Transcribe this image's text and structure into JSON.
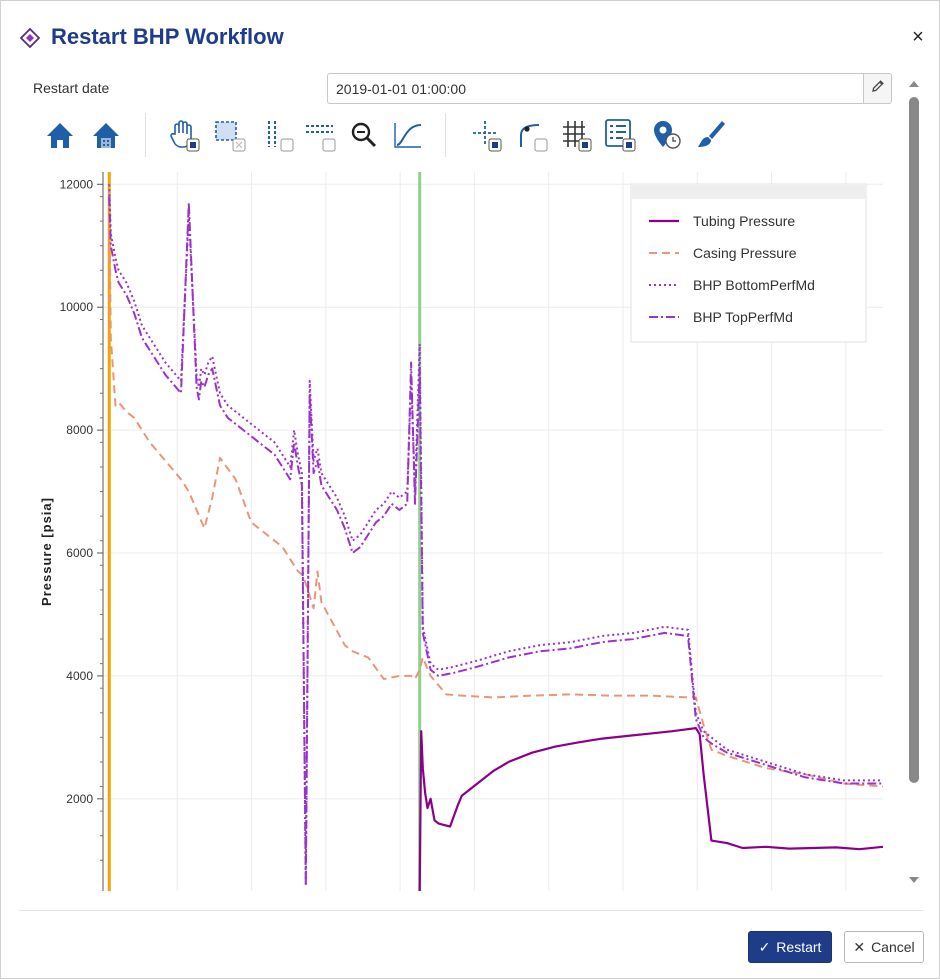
{
  "dialog": {
    "title": "Restart BHP Workflow",
    "title_icon": "diamond-workflow-icon",
    "close_icon": "close-icon",
    "close_label": "×"
  },
  "restart_date": {
    "label": "Restart date",
    "value": "2019-01-01 01:00:00",
    "edit_icon": "pencil-icon"
  },
  "toolbar": {
    "tools": [
      {
        "name": "reset-view-tool",
        "icon": "home-icon"
      },
      {
        "name": "save-view-tool",
        "icon": "home-solid-icon"
      },
      {
        "name": "pan-tool",
        "icon": "hand-pan-icon"
      },
      {
        "name": "box-zoom-tool",
        "icon": "box-zoom-icon"
      },
      {
        "name": "xbox-select-tool",
        "icon": "vertical-select-icon"
      },
      {
        "name": "ybox-select-tool",
        "icon": "horizontal-select-icon"
      },
      {
        "name": "zoom-tool",
        "icon": "magnifier-icon"
      },
      {
        "name": "curve-tool",
        "icon": "curve-icon"
      },
      {
        "name": "crosshair-tool",
        "icon": "crosshair-icon"
      },
      {
        "name": "point-draw-tool",
        "icon": "point-draw-icon"
      },
      {
        "name": "grid-tool",
        "icon": "grid-icon"
      },
      {
        "name": "legend-tool",
        "icon": "legend-list-icon"
      },
      {
        "name": "hover-tool",
        "icon": "hover-clock-icon"
      },
      {
        "name": "paint-tool",
        "icon": "paint-brush-icon"
      }
    ]
  },
  "chart_data": {
    "type": "line",
    "title": "",
    "xlabel": "",
    "ylabel": "Pressure [psia]",
    "ylim": [
      500,
      12200
    ],
    "yticks": [
      2000,
      4000,
      6000,
      8000,
      10000,
      12000
    ],
    "ytick_labels": [
      "2000",
      "4000",
      "6000",
      "8000",
      "10000",
      "12000"
    ],
    "xlim": [
      0,
      100
    ],
    "grid": true,
    "legend": "top-right",
    "vertical_markers": [
      {
        "x": 0.8,
        "color": "#f4a300"
      },
      {
        "x": 40.6,
        "color": "#8fd18a"
      }
    ],
    "series": [
      {
        "name": "Tubing Pressure",
        "color": "#8b008b",
        "dash": "solid",
        "width": 2.2,
        "x": [
          40.6,
          40.8,
          41.0,
          41.3,
          41.6,
          42.0,
          42.5,
          43.0,
          43.5,
          44.5,
          45.5,
          46.0,
          48.0,
          50.0,
          52.0,
          55.0,
          58.0,
          61.0,
          64.0,
          67.0,
          70.0,
          73.0,
          76.0,
          76.5,
          77.0,
          78.0,
          80.0,
          82.0,
          85.0,
          88.0,
          91.0,
          94.0,
          97.0,
          100.0
        ],
        "values": [
          500,
          3100,
          2500,
          2100,
          1850,
          2000,
          1650,
          1600,
          1580,
          1550,
          1900,
          2050,
          2250,
          2450,
          2600,
          2750,
          2850,
          2920,
          2980,
          3020,
          3060,
          3100,
          3150,
          3050,
          2400,
          1320,
          1280,
          1200,
          1220,
          1190,
          1200,
          1210,
          1180,
          1220
        ]
      },
      {
        "name": "Casing Pressure",
        "color": "#e8967a",
        "dash": "dashed",
        "width": 2,
        "x": [
          0.8,
          1.0,
          1.6,
          2.0,
          3.0,
          4.0,
          5.0,
          6.0,
          8.0,
          10.0,
          11.0,
          12.0,
          13.0,
          14.0,
          15.0,
          17.0,
          19.0,
          21.0,
          23.0,
          24.0,
          25.0,
          25.5,
          26.0,
          26.5,
          27.0,
          27.5,
          28.0,
          31.0,
          32.0,
          34.0,
          36.0,
          38.0,
          39.0,
          39.5,
          40.0,
          40.6,
          41.0,
          42.0,
          43.0,
          44.0,
          46.0,
          50.0,
          55.0,
          60.0,
          65.0,
          70.0,
          75.0,
          76.0,
          77.0,
          78.0,
          80.0,
          85.0,
          90.0,
          95.0,
          100.0
        ],
        "values": [
          11900,
          9500,
          8400,
          8450,
          8300,
          8200,
          8000,
          7800,
          7500,
          7200,
          7000,
          6700,
          6400,
          6900,
          7550,
          7200,
          6500,
          6300,
          6100,
          5900,
          5700,
          5650,
          5500,
          5300,
          5100,
          5700,
          5200,
          4500,
          4400,
          4300,
          3950,
          4000,
          4000,
          4000,
          3950,
          4100,
          4300,
          4000,
          3850,
          3700,
          3680,
          3650,
          3680,
          3700,
          3680,
          3680,
          3650,
          3650,
          3200,
          2800,
          2700,
          2500,
          2400,
          2250,
          2200
        ]
      },
      {
        "name": "BHP BottomPerfMd",
        "color": "#9933cc",
        "dash": "dotted",
        "width": 2,
        "x": [
          0.8,
          1.0,
          1.6,
          2.0,
          3.0,
          4.0,
          5.0,
          6.0,
          7.0,
          8.0,
          10.0,
          11.0,
          12.0,
          12.3,
          12.6,
          13.0,
          13.5,
          14.0,
          15.0,
          16.0,
          18.0,
          20.0,
          22.0,
          24.0,
          24.5,
          25.0,
          25.5,
          26.0,
          26.5,
          27.0,
          27.5,
          28.0,
          29.0,
          30.0,
          31.0,
          32.0,
          33.0,
          34.0,
          35.0,
          36.0,
          37.0,
          38.0,
          39.0,
          39.5,
          40.0,
          40.6,
          41.0,
          42.0,
          43.0,
          45.0,
          48.0,
          52.0,
          56.0,
          60.0,
          64.0,
          68.0,
          72.0,
          75.0,
          76.0,
          77.0,
          78.0,
          80.0,
          85.0,
          90.0,
          95.0,
          100.0
        ],
        "values": [
          12000,
          11200,
          10800,
          10600,
          10400,
          10100,
          9700,
          9500,
          9300,
          9100,
          8800,
          11500,
          8900,
          8700,
          9000,
          8900,
          9100,
          9200,
          8600,
          8400,
          8200,
          8000,
          7800,
          7400,
          8000,
          7600,
          7300,
          600,
          8800,
          7500,
          7700,
          7300,
          7100,
          6900,
          6600,
          6200,
          6300,
          6500,
          6700,
          6800,
          7000,
          6900,
          7000,
          8800,
          7000,
          9400,
          4800,
          4200,
          4100,
          4150,
          4250,
          4400,
          4500,
          4550,
          4650,
          4700,
          4800,
          4750,
          3400,
          3100,
          3000,
          2800,
          2600,
          2400,
          2300,
          2300
        ]
      },
      {
        "name": "BHP TopPerfMd",
        "color": "#9933cc",
        "dash": "dashdot",
        "width": 2,
        "x": [
          0.8,
          1.0,
          1.6,
          2.0,
          3.0,
          4.0,
          5.0,
          6.0,
          7.0,
          8.0,
          10.0,
          11.0,
          12.0,
          12.3,
          12.6,
          13.0,
          13.5,
          14.0,
          15.0,
          16.0,
          18.0,
          20.0,
          22.0,
          24.0,
          24.5,
          25.0,
          25.5,
          26.0,
          26.5,
          27.0,
          27.5,
          28.0,
          29.0,
          30.0,
          31.0,
          32.0,
          33.0,
          34.0,
          35.0,
          36.0,
          37.0,
          38.0,
          39.0,
          39.5,
          40.0,
          40.6,
          41.0,
          42.0,
          43.0,
          45.0,
          48.0,
          52.0,
          56.0,
          60.0,
          64.0,
          68.0,
          72.0,
          75.0,
          76.0,
          77.0,
          78.0,
          80.0,
          85.0,
          90.0,
          95.0,
          100.0
        ],
        "values": [
          11800,
          11000,
          10600,
          10400,
          10200,
          9900,
          9500,
          9300,
          9100,
          8900,
          8600,
          11700,
          8700,
          8500,
          8800,
          8700,
          8900,
          9000,
          8400,
          8200,
          8000,
          7800,
          7600,
          7200,
          7800,
          7400,
          7100,
          600,
          8600,
          7300,
          7500,
          7100,
          6900,
          6700,
          6400,
          6000,
          6100,
          6300,
          6500,
          6600,
          6800,
          6700,
          6800,
          9100,
          6800,
          9000,
          4700,
          4100,
          4000,
          4050,
          4150,
          4300,
          4400,
          4450,
          4550,
          4600,
          4700,
          4650,
          3300,
          3000,
          2900,
          2750,
          2550,
          2350,
          2250,
          2250
        ]
      }
    ]
  },
  "scrollbar": {
    "up_icon": "scroll-up-arrow-icon",
    "down_icon": "scroll-down-arrow-icon"
  },
  "footer": {
    "restart_label": "Restart",
    "restart_icon": "check-icon",
    "cancel_label": "Cancel",
    "cancel_icon": "x-icon"
  }
}
